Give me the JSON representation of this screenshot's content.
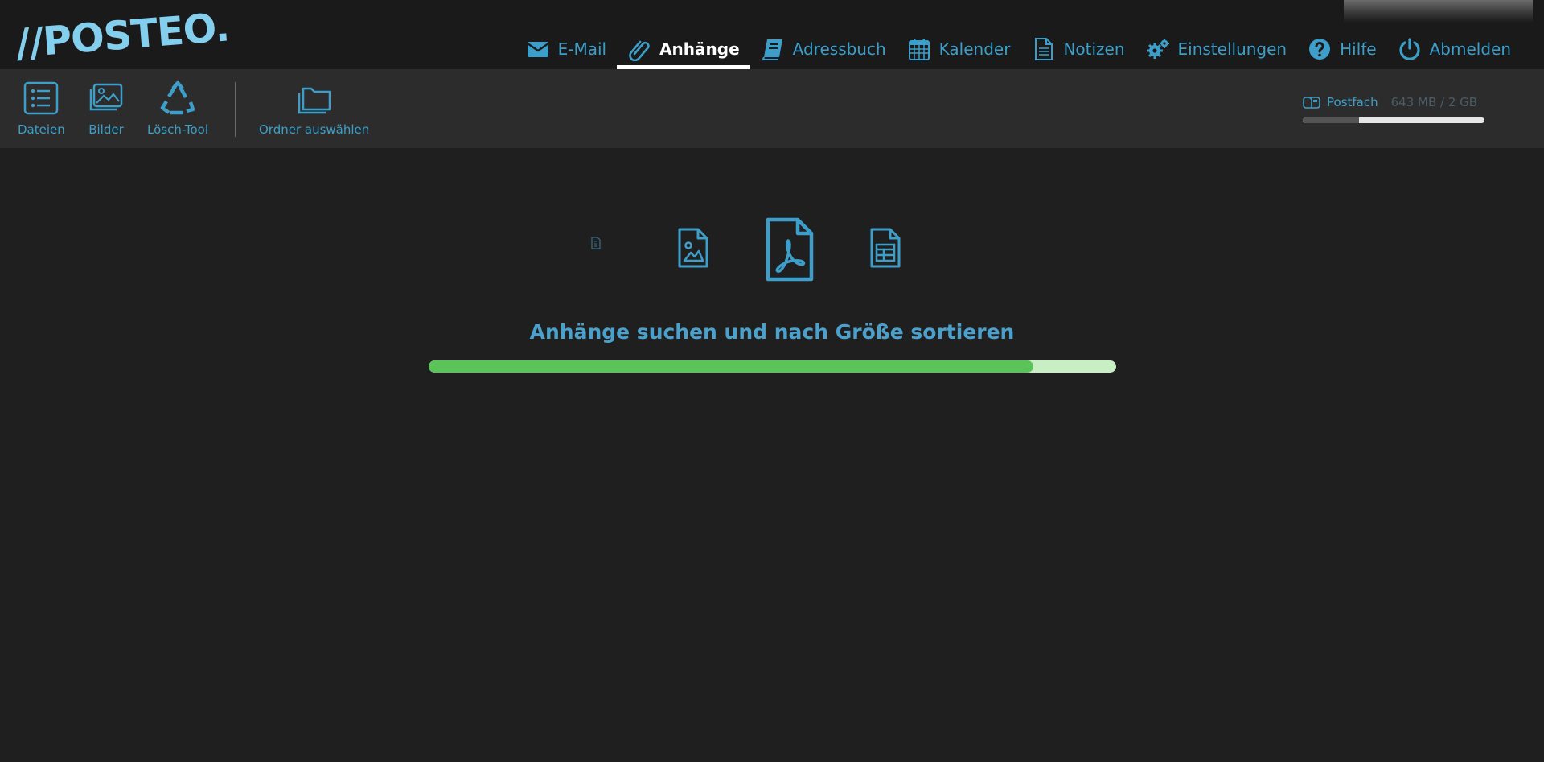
{
  "logo": {
    "text": "//POSTEO."
  },
  "nav": {
    "items": [
      {
        "label": "E-Mail",
        "icon": "envelope-icon",
        "active": false
      },
      {
        "label": "Anhänge",
        "icon": "paperclip-icon",
        "active": true
      },
      {
        "label": "Adressbuch",
        "icon": "book-icon",
        "active": false
      },
      {
        "label": "Kalender",
        "icon": "calendar-icon",
        "active": false
      },
      {
        "label": "Notizen",
        "icon": "note-icon",
        "active": false
      },
      {
        "label": "Einstellungen",
        "icon": "gears-icon",
        "active": false
      },
      {
        "label": "Hilfe",
        "icon": "question-icon",
        "active": false
      },
      {
        "label": "Abmelden",
        "icon": "power-icon",
        "active": false
      }
    ]
  },
  "toolbar": {
    "files_label": "Dateien",
    "images_label": "Bilder",
    "delete_tool_label": "Lösch-Tool",
    "choose_folder_label": "Ordner auswählen"
  },
  "quota": {
    "label": "Postfach",
    "usage_text": "643 MB / 2 GB",
    "fraction_used": 0.31
  },
  "main": {
    "headline": "Anhänge suchen und nach Größe sortieren",
    "progress_fraction": 0.88,
    "file_type_icons": [
      "small-document-icon",
      "image-file-icon",
      "pdf-file-icon",
      "spreadsheet-file-icon"
    ]
  },
  "colors": {
    "accent": "#3d9fc9",
    "logo": "#84cfed",
    "progress": "#5bc458",
    "progress_track": "#c8efc4",
    "background": "#1f1f1f"
  }
}
